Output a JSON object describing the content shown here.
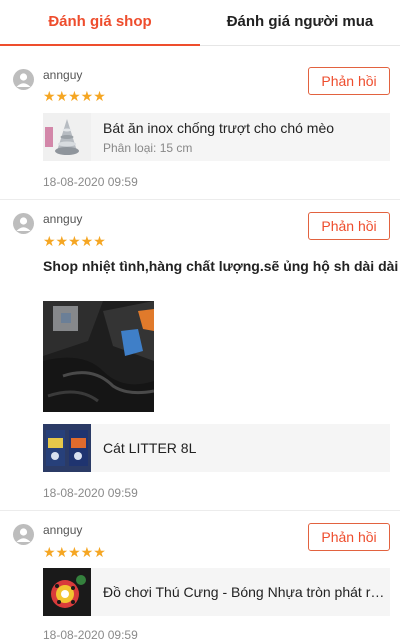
{
  "tabs": [
    {
      "label": "Đánh giá shop",
      "active": true
    },
    {
      "label": "Đánh giá người mua",
      "active": false
    }
  ],
  "colors": {
    "accent": "#ee4d2d",
    "star": "#f5a623"
  },
  "reviews": [
    {
      "username": "annguy",
      "stars": "★★★★★",
      "rating": 5,
      "reply_label": "Phản hồi",
      "product": {
        "name": "Bát ăn inox chống trượt cho chó mèo",
        "variant": "Phân loại: 15 cm",
        "thumb_icon": "steel-bowl-icon"
      },
      "date": "18-08-2020 09:59"
    },
    {
      "username": "annguy",
      "stars": "★★★★★",
      "rating": 5,
      "reply_label": "Phản hồi",
      "comment": "Shop nhiệt tình,hàng chất lượng.sẽ ủng hộ sh dài dài",
      "product": {
        "name": "Cát LITTER 8L",
        "thumb_icon": "litter-bag-icon"
      },
      "date": "18-08-2020 09:59"
    },
    {
      "username": "annguy",
      "stars": "★★★★★",
      "rating": 5,
      "reply_label": "Phản hồi",
      "product": {
        "name": "Đồ chơi Thú Cưng - Bóng Nhựa tròn phát ra tiếng chuông",
        "thumb_icon": "ball-toy-icon"
      },
      "date": "18-08-2020 09:59"
    }
  ]
}
